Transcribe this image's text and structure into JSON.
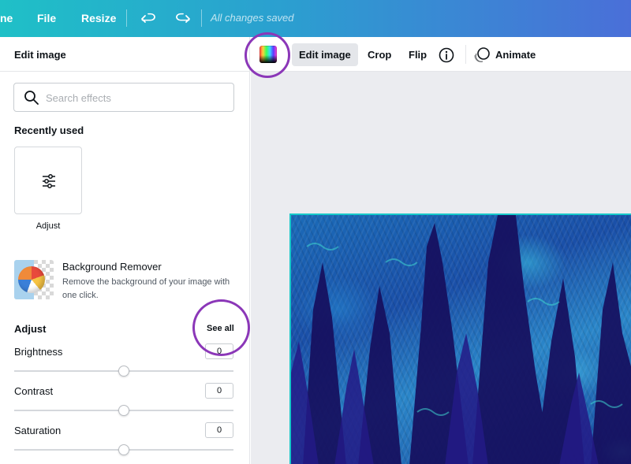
{
  "topbar": {
    "home_label": "ne",
    "file_label": "File",
    "resize_label": "Resize",
    "saved_status": "All changes saved"
  },
  "toolbar": {
    "edit_image_label": "Edit image",
    "crop_label": "Crop",
    "flip_label": "Flip",
    "animate_label": "Animate"
  },
  "panel": {
    "title": "Edit image",
    "search_placeholder": "Search effects",
    "recently_used_heading": "Recently used",
    "recent_items": [
      {
        "label": "Adjust",
        "icon": "sliders-icon"
      }
    ],
    "background_remover": {
      "title": "Background Remover",
      "description": "Remove the background of your image with one click."
    },
    "adjust": {
      "heading": "Adjust",
      "see_all_label": "See all",
      "sliders": [
        {
          "label": "Brightness",
          "value": "0",
          "fraction": 0.5
        },
        {
          "label": "Contrast",
          "value": "0",
          "fraction": 0.5
        },
        {
          "label": "Saturation",
          "value": "0",
          "fraction": 0.5
        }
      ]
    }
  },
  "colors": {
    "highlight_ring": "#8b37b8",
    "selection_border": "#17c8c9",
    "topbar_gradient_start": "#1fc0c7",
    "topbar_gradient_end": "#4a6fd8"
  }
}
